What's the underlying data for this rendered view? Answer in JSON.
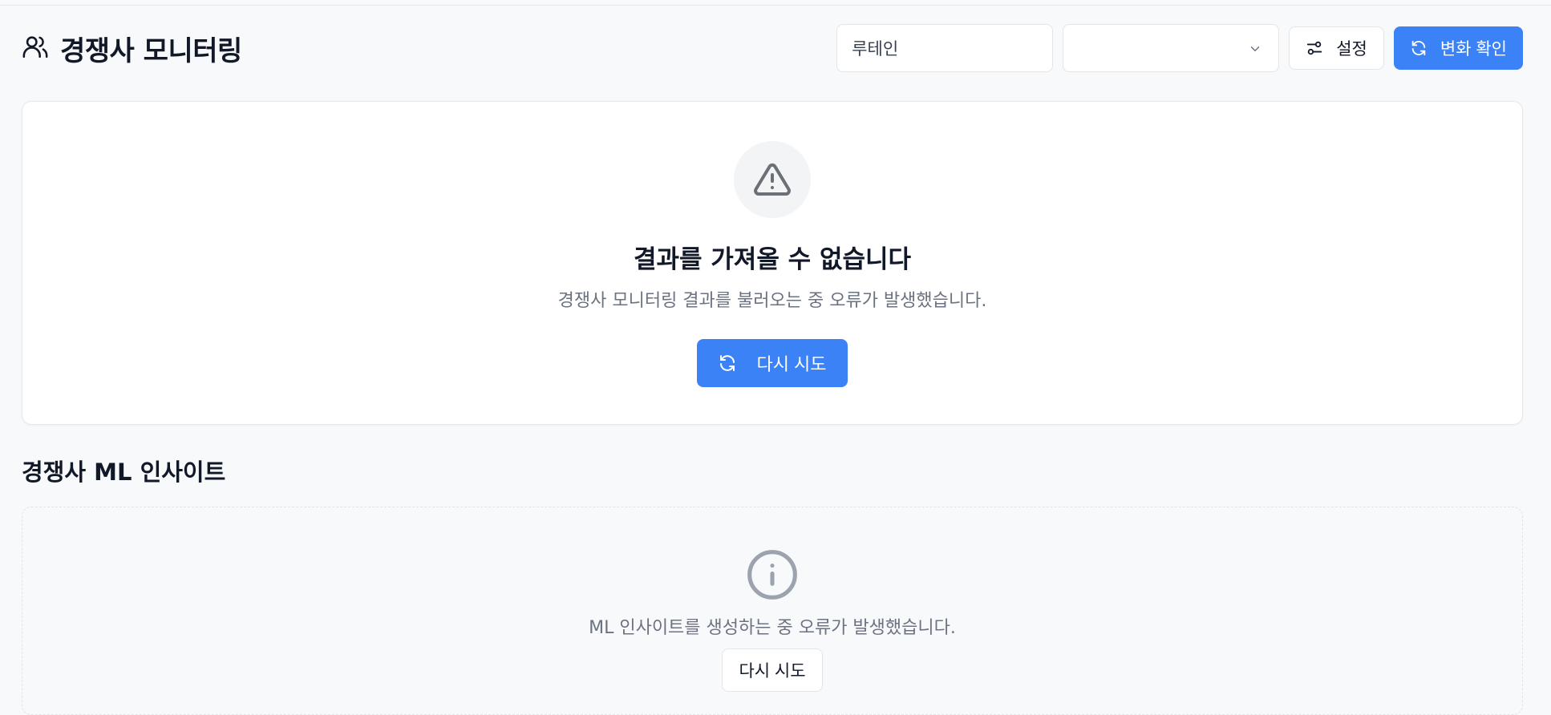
{
  "header": {
    "title": "경쟁사 모니터링",
    "brand_input_value": "루테인",
    "select_value": "",
    "settings_label": "설정",
    "check_changes_label": "변화 확인"
  },
  "error_card": {
    "title": "결과를 가져올 수 없습니다",
    "description": "경쟁사 모니터링 결과를 불러오는 중 오류가 발생했습니다.",
    "retry_label": "다시 시도"
  },
  "ml_section": {
    "title": "경쟁사 ML 인사이트",
    "description": "ML 인사이트를 생성하는 중 오류가 발생했습니다.",
    "retry_label": "다시 시도"
  },
  "icons": {
    "title_icon": "users-icon",
    "settings_icon": "sliders-icon",
    "refresh_icon": "refresh-icon",
    "warning_icon": "alert-triangle-icon",
    "info_icon": "info-icon",
    "dropdown_icon": "chevron-down-icon"
  },
  "colors": {
    "primary": "#3b82f6",
    "background": "#f8f9fb",
    "muted_text": "#6b7280"
  }
}
